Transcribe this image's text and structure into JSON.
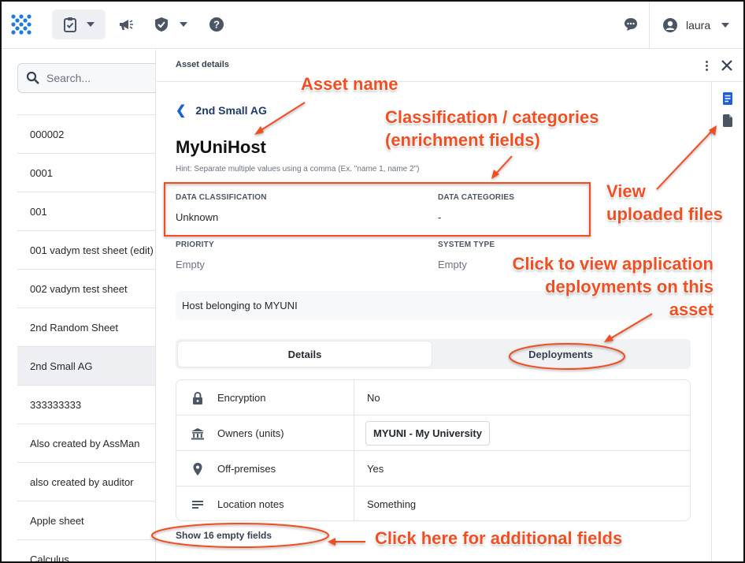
{
  "topbar": {
    "user_name": "laura"
  },
  "left_list": {
    "search_placeholder": "Search...",
    "items": [
      {
        "label": "000002"
      },
      {
        "label": "0001"
      },
      {
        "label": "001"
      },
      {
        "label": "001 vadym test sheet (edit)"
      },
      {
        "label": "002 vadym test sheet"
      },
      {
        "label": "2nd Random Sheet"
      },
      {
        "label": "2nd Small AG",
        "selected": true
      },
      {
        "label": "333333333"
      },
      {
        "label": "Also created by AssMan"
      },
      {
        "label": "also created by auditor"
      },
      {
        "label": "Apple sheet"
      },
      {
        "label": "Calculus"
      }
    ]
  },
  "panel": {
    "title": "Asset details",
    "back_label": "2nd Small AG",
    "asset_name": "MyUniHost",
    "hint": "Hint: Separate multiple values using a comma (Ex. \"name 1, name 2\")",
    "fields": {
      "data_classification_label": "DATA CLASSIFICATION",
      "data_classification_value": "Unknown",
      "data_categories_label": "DATA CATEGORIES",
      "data_categories_value": "-",
      "priority_label": "PRIORITY",
      "priority_value": "Empty",
      "system_type_label": "SYSTEM TYPE",
      "system_type_value": "Empty"
    },
    "description": "Host belonging to MYUNI",
    "tabs": {
      "details": "Details",
      "deployments": "Deployments"
    },
    "details_rows": [
      {
        "icon": "lock-icon",
        "label": "Encryption",
        "value": "No"
      },
      {
        "icon": "institution-icon",
        "label": "Owners (units)",
        "value": "MYUNI - My University"
      },
      {
        "icon": "location-pin-icon",
        "label": "Off-premises",
        "value": "Yes"
      },
      {
        "icon": "notes-lines-icon",
        "label": "Location notes",
        "value": "Something"
      }
    ],
    "show_empty_fields": "Show 16 empty fields"
  },
  "annotations": {
    "asset_name": "Asset name",
    "classification_line1": "Classification / categories",
    "classification_line2": "(enrichment fields)",
    "view_files_line1": "View",
    "view_files_line2": "uploaded files",
    "deployments_line1": "Click to view application",
    "deployments_line2": "deployments on this",
    "deployments_line3": "asset",
    "additional_fields": "Click here for additional fields"
  },
  "colors": {
    "annotation": "#f04e23",
    "accent_blue": "#1f5fd6"
  }
}
